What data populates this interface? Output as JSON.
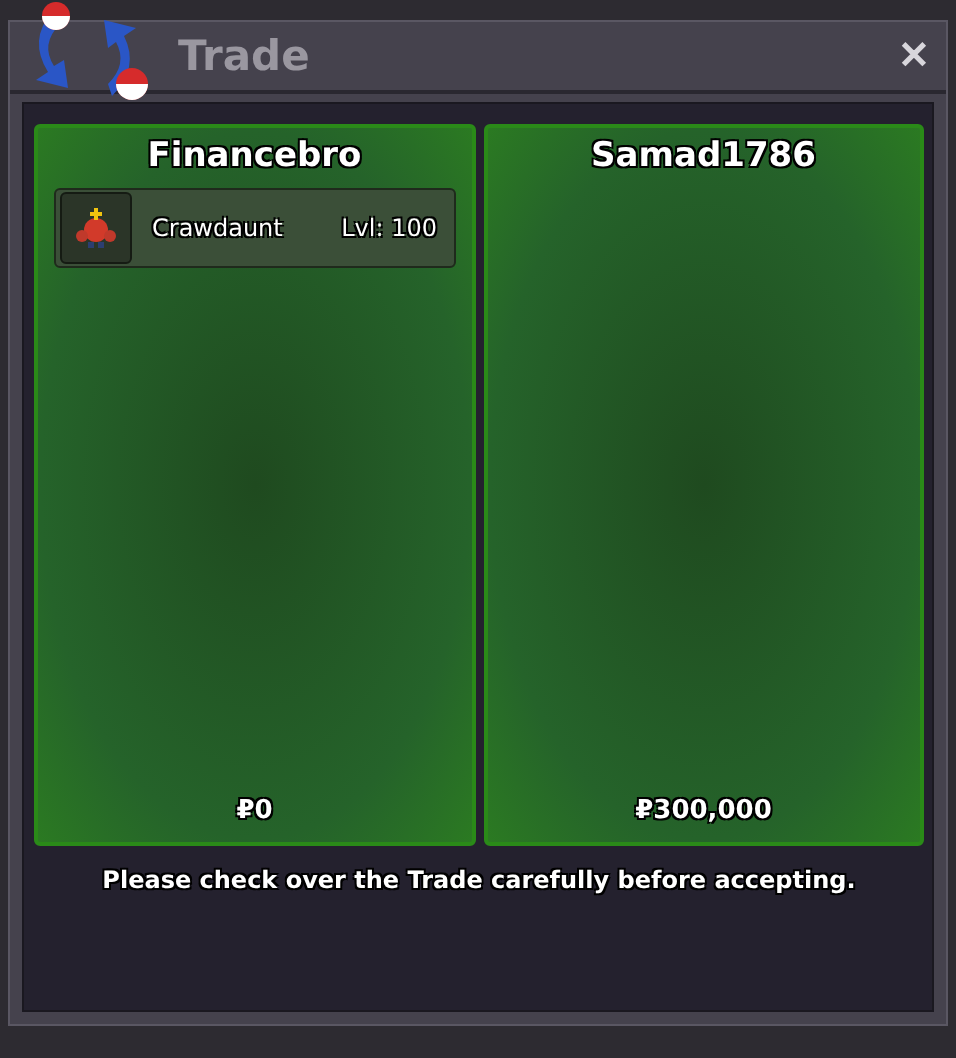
{
  "window": {
    "title": "Trade",
    "close": "✕"
  },
  "sides": [
    {
      "player": "Financebro",
      "items": [
        {
          "kind": "pokemon",
          "name": "Crawdaunt",
          "level": "Lvl: 100"
        }
      ],
      "money": "₽0"
    },
    {
      "player": "Samad1786",
      "money": "₽300,000"
    }
  ],
  "message": "Please check over the Trade carefully before accepting."
}
